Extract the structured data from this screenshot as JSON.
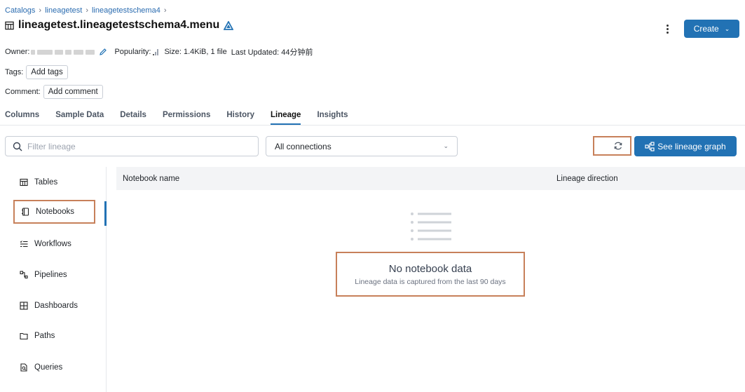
{
  "breadcrumb": [
    "Catalogs",
    "lineagetest",
    "lineagetestschema4"
  ],
  "breadcrumb_sep": "›",
  "table_title": "lineagetest.lineagetestschema4.menu",
  "header": {
    "create_label": "Create"
  },
  "meta": {
    "owner_label": "Owner:",
    "popularity_label": "Popularity:",
    "size_text": "Size: 1.4KiB, 1 file",
    "last_updated_text": "Last Updated: 44分钟前"
  },
  "tags": {
    "label": "Tags:",
    "button": "Add tags"
  },
  "comment": {
    "label": "Comment:",
    "button": "Add comment"
  },
  "tabs": [
    "Columns",
    "Sample Data",
    "Details",
    "Permissions",
    "History",
    "Lineage",
    "Insights"
  ],
  "active_tab": "Lineage",
  "filter": {
    "placeholder": "Filter lineage"
  },
  "connections_select": {
    "value": "All connections"
  },
  "lineage_graph_button": "See lineage graph",
  "sidebar": {
    "items": [
      {
        "label": "Tables",
        "icon": "table-icon"
      },
      {
        "label": "Notebooks",
        "icon": "notebook-icon"
      },
      {
        "label": "Workflows",
        "icon": "workflow-icon"
      },
      {
        "label": "Pipelines",
        "icon": "pipeline-icon"
      },
      {
        "label": "Dashboards",
        "icon": "dashboard-icon"
      },
      {
        "label": "Paths",
        "icon": "folder-icon"
      },
      {
        "label": "Queries",
        "icon": "query-icon"
      }
    ],
    "selected": "Notebooks"
  },
  "table": {
    "columns": [
      "Notebook name",
      "Lineage direction"
    ]
  },
  "empty_state": {
    "title": "No notebook data",
    "subtitle": "Lineage data is captured from the last 90 days"
  },
  "colors": {
    "accent": "#2272b4",
    "highlight": "#c7805a"
  }
}
